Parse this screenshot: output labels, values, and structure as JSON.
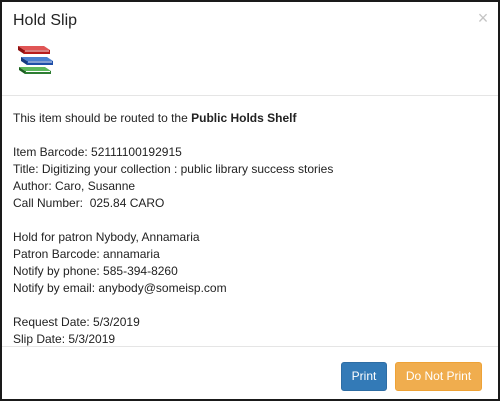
{
  "dialog": {
    "title": "Hold Slip",
    "close_symbol": "×",
    "icon": "books-stack-icon"
  },
  "body": {
    "routing_prefix": "This item should be routed to the ",
    "routing_destination": "Public Holds Shelf",
    "item": {
      "barcode": "Item Barcode: 52111100192915",
      "title": "Title: Digitizing your collection : public library success stories",
      "author": "Author: Caro, Susanne",
      "call_number": "Call Number:  025.84 CARO"
    },
    "patron": {
      "hold_for": "Hold for patron Nybody, Annamaria",
      "barcode": "Patron Barcode: annamaria",
      "phone": "Notify by phone: 585-394-8260",
      "email": "Notify by email: anybody@someisp.com"
    },
    "dates": {
      "request": "Request Date: 5/3/2019",
      "slip": "Slip Date: 5/3/2019"
    }
  },
  "footer": {
    "print_label": "Print",
    "do_not_print_label": "Do Not Print"
  },
  "colors": {
    "print_button": "#337ab7",
    "do_not_print_button": "#f0ad4e"
  }
}
